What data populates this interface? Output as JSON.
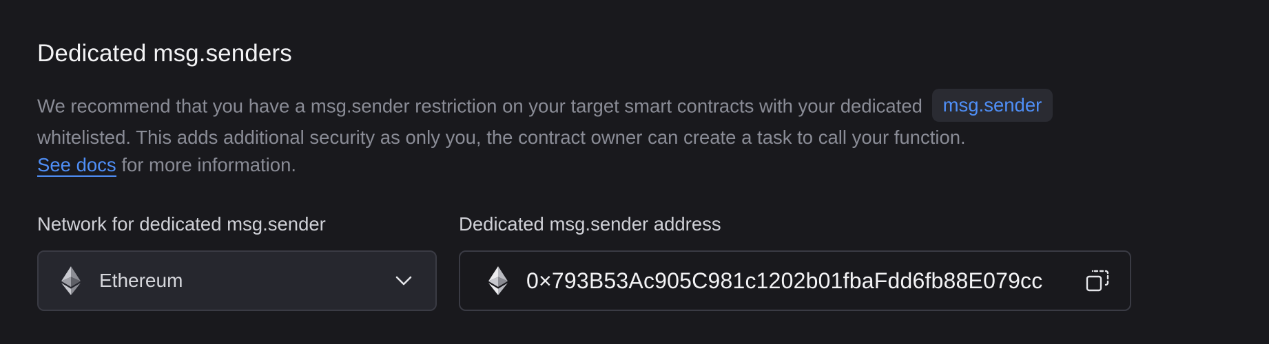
{
  "section": {
    "title": "Dedicated msg.senders",
    "description_part1": "We recommend that you have a msg.sender restriction on your target smart contracts with your dedicated",
    "code_chip": "msg.sender",
    "description_part2": "whitelisted. This adds additional security as only you, the contract owner can create a task to call your function.",
    "docs_link": "See docs",
    "description_part3": "for more information."
  },
  "network_field": {
    "label": "Network for dedicated msg.sender",
    "selected": "Ethereum",
    "icon": "ethereum-icon"
  },
  "address_field": {
    "label": "Dedicated msg.sender address",
    "value": "0×793B53Ac905C981c1202b01fbaFdd6fb88E079cc",
    "icon": "ethereum-icon",
    "copy_icon": "copy-icon"
  },
  "colors": {
    "background": "#19191d",
    "link": "#4f8ff7",
    "muted_text": "#8a8c96",
    "border": "#3a3b44"
  }
}
